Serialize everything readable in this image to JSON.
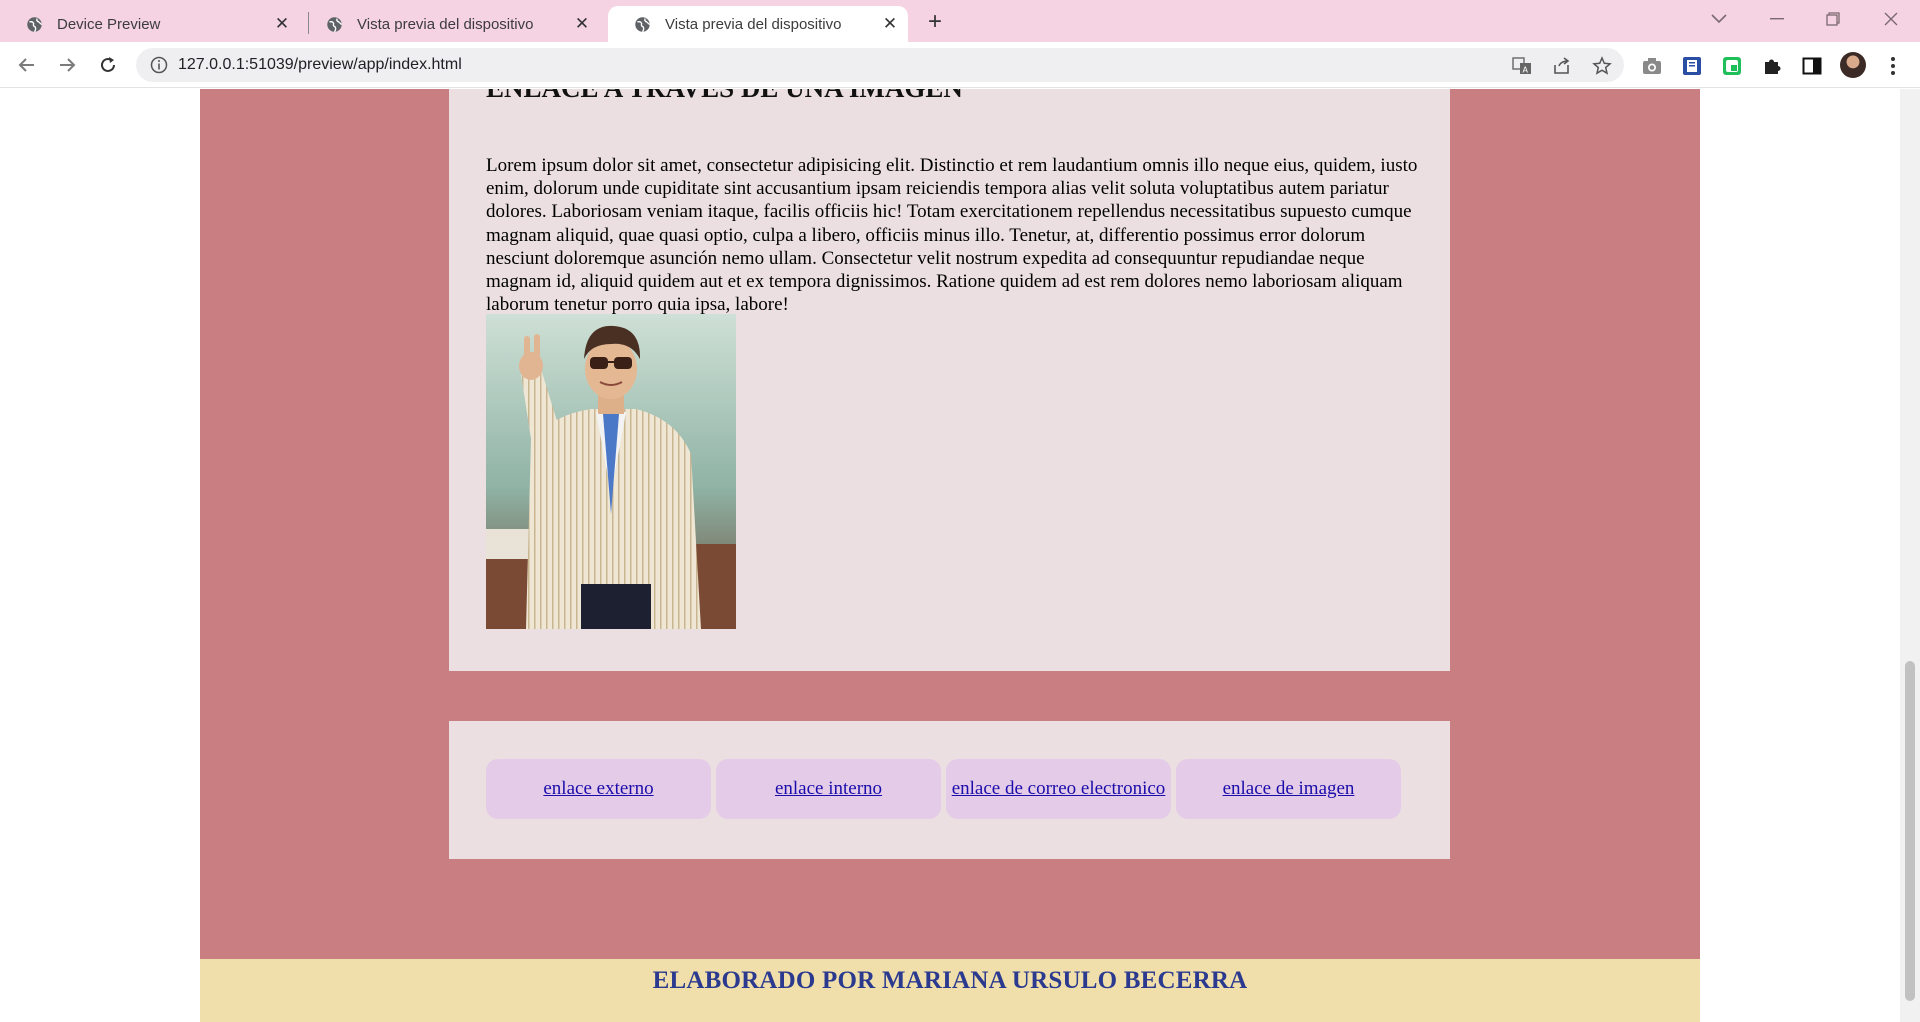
{
  "browser": {
    "tabs": [
      {
        "title": "Device Preview",
        "active": false
      },
      {
        "title": "Vista previa del dispositivo",
        "active": false
      },
      {
        "title": "Vista previa del dispositivo",
        "active": true
      }
    ],
    "url": "127.0.0.1:51039/preview/app/index.html",
    "icons": [
      "globe-icon",
      "close-icon",
      "plus-icon",
      "back-icon",
      "forward-icon",
      "reload-icon",
      "info-icon",
      "translate-icon",
      "share-icon",
      "star-icon",
      "camera-icon",
      "extension-icon",
      "puzzle-icon",
      "sidepanel-icon",
      "avatar"
    ]
  },
  "page": {
    "section_title": "ENLACE A TRAVÉS DE UNA IMAGEN",
    "paragraph": "Lorem ipsum dolor sit amet, consectetur adipisicing elit. Distinctio et rem laudantium omnis illo neque eius, quidem, iusto enim, dolorum unde cupiditate sint accusantium ipsam reiciendis tempora alias velit soluta voluptatibus autem pariatur dolores. Laboriosam veniam itaque, facilis officiis hic! Totam exercitationem repellendus necessitatibus supuesto cumque magnam aliquid, quae quasi optio, culpa a libero, officiis minus illo. Tenetur, at, differentio possimus error dolorum nesciunt doloremque asunción nemo ullam. Consectetur velit nostrum expedita ad consequuntur repudiandae neque magnam id, aliquid quidem aut et ex tempora dignissimos. Ratione quidem ad est rem dolores nemo laboriosam aliquam laborum tenetur porro quia ipsa, labore!",
    "links": [
      " enlace externo",
      "enlace interno",
      "enlace de correo electronico",
      " enlace de imagen"
    ],
    "footer": "ELABORADO POR MARIANA URSULO BECERRA"
  },
  "colors": {
    "tabbar": "#f5d3e3",
    "wrapper": "#c97e82",
    "card": "#ebdfe1",
    "link_pill": "#e4cbe8",
    "footer_bg": "#f0dfab",
    "footer_text": "#2b3a8f"
  }
}
